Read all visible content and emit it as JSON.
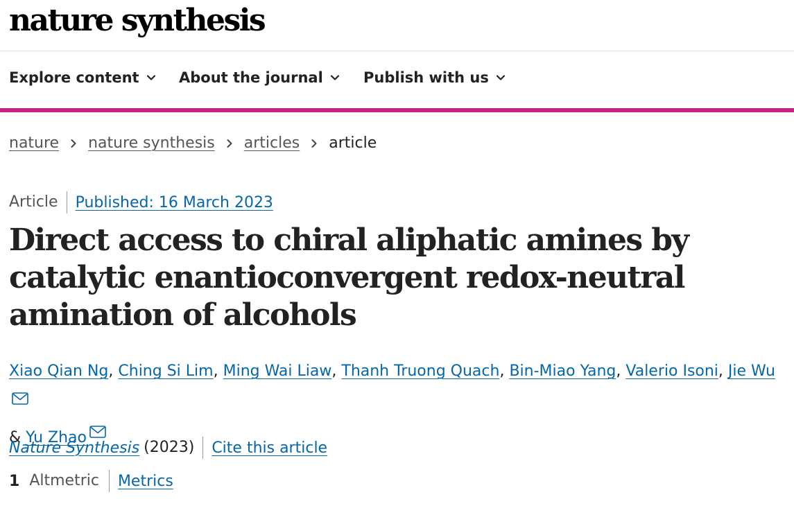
{
  "header": {
    "logo_text": "nature synthesis"
  },
  "nav": {
    "items": [
      {
        "label": "Explore content"
      },
      {
        "label": "About the journal"
      },
      {
        "label": "Publish with us"
      }
    ],
    "accent_color": "#c42285"
  },
  "breadcrumb": {
    "items": [
      "nature",
      "nature synthesis",
      "articles"
    ],
    "current": "article"
  },
  "article": {
    "type": "Article",
    "published": "Published: 16 March 2023",
    "title": "Direct access to chiral aliphatic amines by catalytic enantioconvergent redox-neutral amination of alcohols",
    "authors": [
      "Xiao Qian Ng",
      "Ching Si Lim",
      "Ming Wai Liaw",
      "Thanh Truong Quach",
      "Bin-Miao Yang",
      "Valerio Isoni",
      "Jie Wu",
      "Yu Zhao"
    ],
    "author_separator": ",",
    "author_last_separator": "&",
    "journal": "Nature Synthesis",
    "year": "(2023)",
    "cite_label": "Cite this article",
    "altmetric_count": "1",
    "altmetric_label": "Altmetric",
    "metrics_label": "Metrics"
  },
  "colors": {
    "link": "#0567a8",
    "text": "#222222"
  }
}
